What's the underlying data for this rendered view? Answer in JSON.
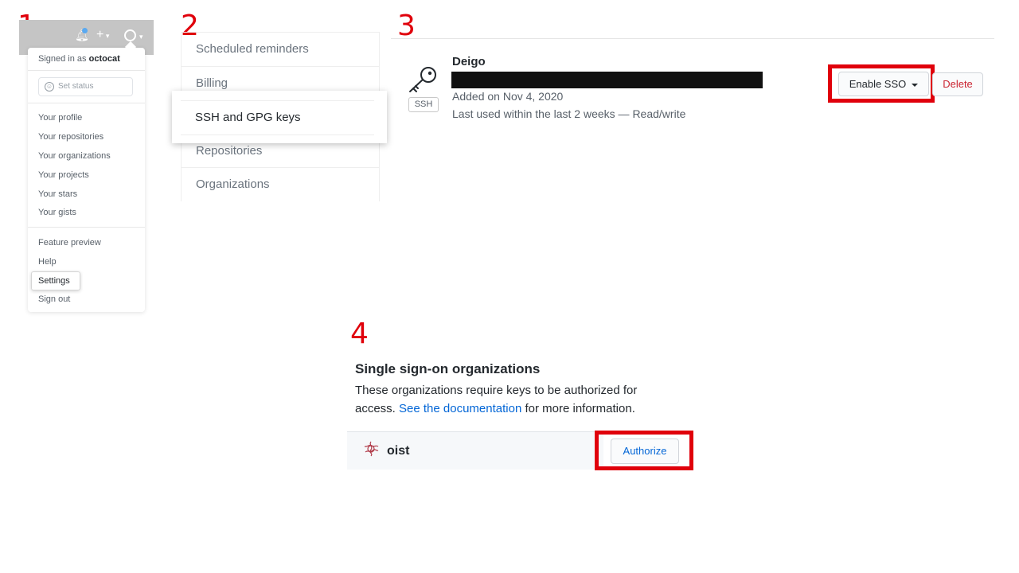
{
  "steps": [
    "1",
    "2",
    "3",
    "4"
  ],
  "colors": {
    "accent_red": "#e0000b",
    "link_blue": "#0366d6",
    "danger": "#cb2431"
  },
  "user_menu": {
    "icons": [
      "bell-icon",
      "plus-icon",
      "avatar-icon"
    ],
    "signed_in_prefix": "Signed in as",
    "username": "octocat",
    "set_status": "Set status",
    "items": [
      "Your profile",
      "Your repositories",
      "Your organizations",
      "Your projects",
      "Your stars",
      "Your gists"
    ],
    "items2": [
      "Feature preview",
      "Help",
      "Settings",
      "Sign out"
    ]
  },
  "settings_nav": {
    "items": [
      "Scheduled reminders",
      "Billing",
      "SSH and GPG keys",
      "Repositories",
      "Organizations"
    ],
    "selected": "SSH and GPG keys"
  },
  "ssh_key": {
    "title": "Deigo",
    "badge": "SSH",
    "added": "Added on Nov 4, 2020",
    "last_used": "Last used within the last 2 weeks — Read/write",
    "enable_sso": "Enable SSO",
    "delete": "Delete"
  },
  "sso": {
    "title": "Single sign-on organizations",
    "desc_line1": "These organizations require keys to be authorized for",
    "desc_pre": "access.",
    "desc_link": "See the documentation",
    "desc_post": "for more information.",
    "org_name": "oist",
    "authorize": "Authorize"
  }
}
